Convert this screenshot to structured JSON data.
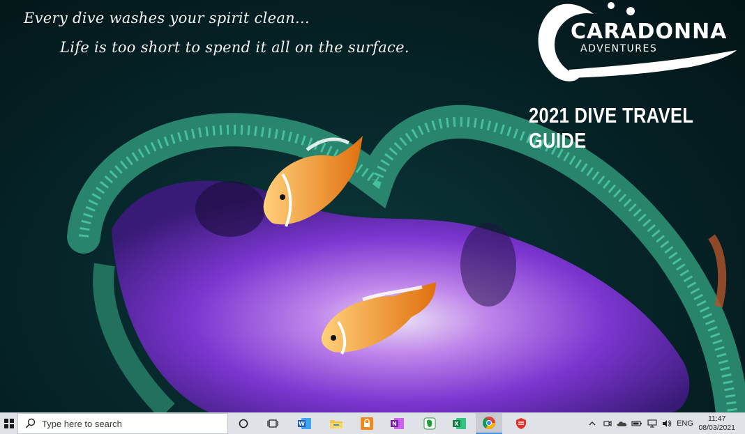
{
  "wallpaper": {
    "quote_line1": "Every dive washes your spirit clean...",
    "quote_line2": "Life is too short to spend it all on the surface.",
    "brand_name": "CARADONNA",
    "brand_sub": "ADVENTURES",
    "guide_title": "2021 DIVE TRAVEL GUIDE"
  },
  "taskbar": {
    "search_placeholder": "Type here to search",
    "apps": [
      "task-view-icon",
      "word-icon",
      "file-explorer-icon",
      "lock-app-icon",
      "onenote-icon",
      "evernote-icon",
      "excel-icon",
      "chrome-icon",
      "vpn-app-icon"
    ],
    "language": "ENG",
    "time": "11:47",
    "date": "08/03/2021"
  },
  "colors": {
    "taskbar_bg": "#dfe3e8",
    "anemone_purple": "#8a3de0",
    "anemone_green": "#2f9a7a",
    "clownfish_orange": "#f08a1c"
  }
}
